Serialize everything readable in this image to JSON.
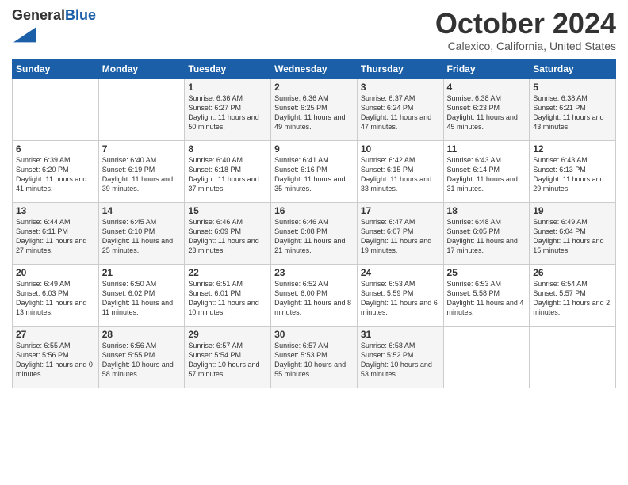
{
  "logo": {
    "general": "General",
    "blue": "Blue"
  },
  "header": {
    "month": "October 2024",
    "location": "Calexico, California, United States"
  },
  "days_of_week": [
    "Sunday",
    "Monday",
    "Tuesday",
    "Wednesday",
    "Thursday",
    "Friday",
    "Saturday"
  ],
  "weeks": [
    [
      {
        "day": "",
        "sunrise": "",
        "sunset": "",
        "daylight": ""
      },
      {
        "day": "",
        "sunrise": "",
        "sunset": "",
        "daylight": ""
      },
      {
        "day": "1",
        "sunrise": "Sunrise: 6:36 AM",
        "sunset": "Sunset: 6:27 PM",
        "daylight": "Daylight: 11 hours and 50 minutes."
      },
      {
        "day": "2",
        "sunrise": "Sunrise: 6:36 AM",
        "sunset": "Sunset: 6:25 PM",
        "daylight": "Daylight: 11 hours and 49 minutes."
      },
      {
        "day": "3",
        "sunrise": "Sunrise: 6:37 AM",
        "sunset": "Sunset: 6:24 PM",
        "daylight": "Daylight: 11 hours and 47 minutes."
      },
      {
        "day": "4",
        "sunrise": "Sunrise: 6:38 AM",
        "sunset": "Sunset: 6:23 PM",
        "daylight": "Daylight: 11 hours and 45 minutes."
      },
      {
        "day": "5",
        "sunrise": "Sunrise: 6:38 AM",
        "sunset": "Sunset: 6:21 PM",
        "daylight": "Daylight: 11 hours and 43 minutes."
      }
    ],
    [
      {
        "day": "6",
        "sunrise": "Sunrise: 6:39 AM",
        "sunset": "Sunset: 6:20 PM",
        "daylight": "Daylight: 11 hours and 41 minutes."
      },
      {
        "day": "7",
        "sunrise": "Sunrise: 6:40 AM",
        "sunset": "Sunset: 6:19 PM",
        "daylight": "Daylight: 11 hours and 39 minutes."
      },
      {
        "day": "8",
        "sunrise": "Sunrise: 6:40 AM",
        "sunset": "Sunset: 6:18 PM",
        "daylight": "Daylight: 11 hours and 37 minutes."
      },
      {
        "day": "9",
        "sunrise": "Sunrise: 6:41 AM",
        "sunset": "Sunset: 6:16 PM",
        "daylight": "Daylight: 11 hours and 35 minutes."
      },
      {
        "day": "10",
        "sunrise": "Sunrise: 6:42 AM",
        "sunset": "Sunset: 6:15 PM",
        "daylight": "Daylight: 11 hours and 33 minutes."
      },
      {
        "day": "11",
        "sunrise": "Sunrise: 6:43 AM",
        "sunset": "Sunset: 6:14 PM",
        "daylight": "Daylight: 11 hours and 31 minutes."
      },
      {
        "day": "12",
        "sunrise": "Sunrise: 6:43 AM",
        "sunset": "Sunset: 6:13 PM",
        "daylight": "Daylight: 11 hours and 29 minutes."
      }
    ],
    [
      {
        "day": "13",
        "sunrise": "Sunrise: 6:44 AM",
        "sunset": "Sunset: 6:11 PM",
        "daylight": "Daylight: 11 hours and 27 minutes."
      },
      {
        "day": "14",
        "sunrise": "Sunrise: 6:45 AM",
        "sunset": "Sunset: 6:10 PM",
        "daylight": "Daylight: 11 hours and 25 minutes."
      },
      {
        "day": "15",
        "sunrise": "Sunrise: 6:46 AM",
        "sunset": "Sunset: 6:09 PM",
        "daylight": "Daylight: 11 hours and 23 minutes."
      },
      {
        "day": "16",
        "sunrise": "Sunrise: 6:46 AM",
        "sunset": "Sunset: 6:08 PM",
        "daylight": "Daylight: 11 hours and 21 minutes."
      },
      {
        "day": "17",
        "sunrise": "Sunrise: 6:47 AM",
        "sunset": "Sunset: 6:07 PM",
        "daylight": "Daylight: 11 hours and 19 minutes."
      },
      {
        "day": "18",
        "sunrise": "Sunrise: 6:48 AM",
        "sunset": "Sunset: 6:05 PM",
        "daylight": "Daylight: 11 hours and 17 minutes."
      },
      {
        "day": "19",
        "sunrise": "Sunrise: 6:49 AM",
        "sunset": "Sunset: 6:04 PM",
        "daylight": "Daylight: 11 hours and 15 minutes."
      }
    ],
    [
      {
        "day": "20",
        "sunrise": "Sunrise: 6:49 AM",
        "sunset": "Sunset: 6:03 PM",
        "daylight": "Daylight: 11 hours and 13 minutes."
      },
      {
        "day": "21",
        "sunrise": "Sunrise: 6:50 AM",
        "sunset": "Sunset: 6:02 PM",
        "daylight": "Daylight: 11 hours and 11 minutes."
      },
      {
        "day": "22",
        "sunrise": "Sunrise: 6:51 AM",
        "sunset": "Sunset: 6:01 PM",
        "daylight": "Daylight: 11 hours and 10 minutes."
      },
      {
        "day": "23",
        "sunrise": "Sunrise: 6:52 AM",
        "sunset": "Sunset: 6:00 PM",
        "daylight": "Daylight: 11 hours and 8 minutes."
      },
      {
        "day": "24",
        "sunrise": "Sunrise: 6:53 AM",
        "sunset": "Sunset: 5:59 PM",
        "daylight": "Daylight: 11 hours and 6 minutes."
      },
      {
        "day": "25",
        "sunrise": "Sunrise: 6:53 AM",
        "sunset": "Sunset: 5:58 PM",
        "daylight": "Daylight: 11 hours and 4 minutes."
      },
      {
        "day": "26",
        "sunrise": "Sunrise: 6:54 AM",
        "sunset": "Sunset: 5:57 PM",
        "daylight": "Daylight: 11 hours and 2 minutes."
      }
    ],
    [
      {
        "day": "27",
        "sunrise": "Sunrise: 6:55 AM",
        "sunset": "Sunset: 5:56 PM",
        "daylight": "Daylight: 11 hours and 0 minutes."
      },
      {
        "day": "28",
        "sunrise": "Sunrise: 6:56 AM",
        "sunset": "Sunset: 5:55 PM",
        "daylight": "Daylight: 10 hours and 58 minutes."
      },
      {
        "day": "29",
        "sunrise": "Sunrise: 6:57 AM",
        "sunset": "Sunset: 5:54 PM",
        "daylight": "Daylight: 10 hours and 57 minutes."
      },
      {
        "day": "30",
        "sunrise": "Sunrise: 6:57 AM",
        "sunset": "Sunset: 5:53 PM",
        "daylight": "Daylight: 10 hours and 55 minutes."
      },
      {
        "day": "31",
        "sunrise": "Sunrise: 6:58 AM",
        "sunset": "Sunset: 5:52 PM",
        "daylight": "Daylight: 10 hours and 53 minutes."
      },
      {
        "day": "",
        "sunrise": "",
        "sunset": "",
        "daylight": ""
      },
      {
        "day": "",
        "sunrise": "",
        "sunset": "",
        "daylight": ""
      }
    ]
  ]
}
